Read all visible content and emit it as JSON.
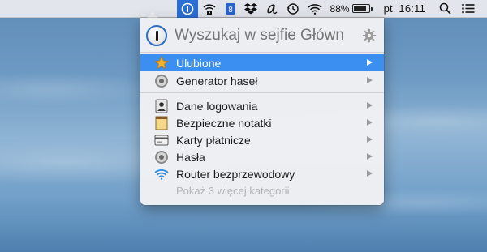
{
  "menubar": {
    "battery_percent_label": "88%",
    "battery_level": 0.88,
    "clock": "pt. 16:11",
    "icons": [
      "onepassword-menu-icon",
      "wifi-lock-icon",
      "blue-app-icon",
      "dropbox-icon",
      "script-a-icon",
      "time-machine-icon",
      "wifi-icon",
      "battery-icon",
      "spotlight-search-icon",
      "notification-center-icon"
    ],
    "active_color": "#2a6fd6"
  },
  "popup": {
    "search_placeholder": "Wyszukaj w sejfie Główny",
    "settings_icon": "gear-icon",
    "favorites": [
      {
        "label": "Ulubione",
        "icon": "star-icon",
        "selected": true
      },
      {
        "label": "Generator haseł",
        "icon": "password-generator-icon",
        "selected": false
      }
    ],
    "categories": [
      {
        "label": "Dane logowania",
        "icon": "login-icon"
      },
      {
        "label": "Bezpieczne notatki",
        "icon": "secure-note-icon"
      },
      {
        "label": "Karty płatnicze",
        "icon": "credit-card-icon"
      },
      {
        "label": "Hasła",
        "icon": "password-icon"
      },
      {
        "label": "Router bezprzewodowy",
        "icon": "wireless-router-icon"
      }
    ],
    "more_categories_label": "Pokaż 3 więcej kategorii",
    "selection_color": "#3a8ff0"
  }
}
